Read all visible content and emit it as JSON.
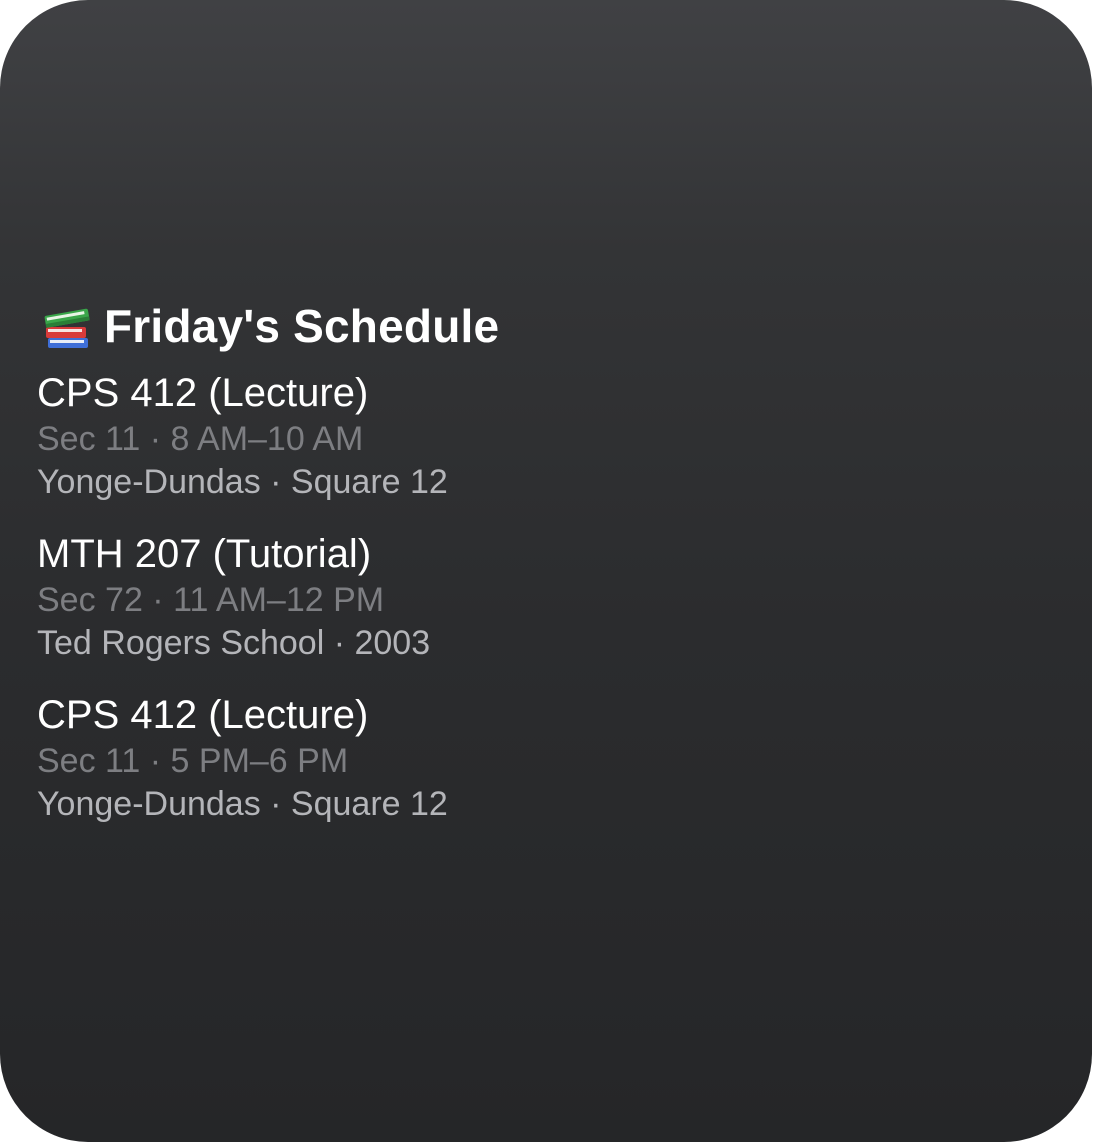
{
  "widget": {
    "title": "Friday's Schedule",
    "icon": "books-emoji-icon",
    "colors": {
      "background_top": "#404144",
      "background_bottom": "#252628",
      "course_text": "#ffffff",
      "time_text": "#7d7e82",
      "location_text": "#b4b5b9"
    },
    "events": [
      {
        "course": "CPS 412 (Lecture)",
        "time": "Sec 11 · 8 AM–10 AM",
        "location": "Yonge-Dundas · Square 12"
      },
      {
        "course": "MTH 207 (Tutorial)",
        "time": "Sec 72 · 11 AM–12 PM",
        "location": "Ted Rogers School · 2003"
      },
      {
        "course": "CPS 412 (Lecture)",
        "time": "Sec 11 · 5 PM–6 PM",
        "location": "Yonge-Dundas · Square 12"
      }
    ]
  }
}
